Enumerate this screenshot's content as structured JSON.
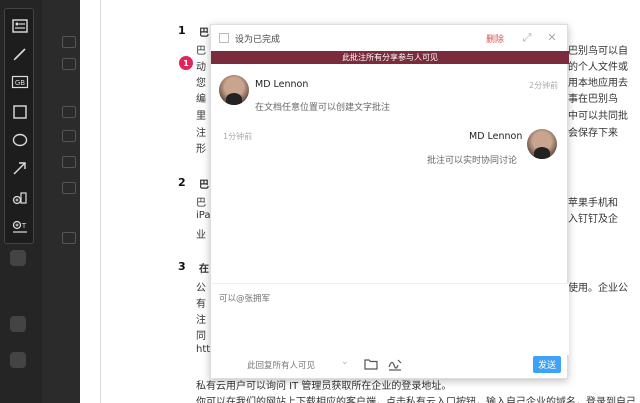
{
  "toolbar": {
    "tools": [
      {
        "name": "text-comment-tool"
      },
      {
        "name": "pencil-tool"
      },
      {
        "name": "gb-tool",
        "label": "GB"
      },
      {
        "name": "rectangle-tool"
      },
      {
        "name": "ellipse-tool"
      },
      {
        "name": "arrow-tool"
      },
      {
        "name": "add-shape-tool"
      },
      {
        "name": "add-text-tool"
      }
    ]
  },
  "document": {
    "sections": [
      {
        "number": "1",
        "heading": "巴"
      },
      {
        "number": "2",
        "heading": "巴"
      },
      {
        "number": "3",
        "heading": "在"
      }
    ],
    "left_lines": [
      "巴",
      "动",
      "您",
      "编",
      "里",
      "注",
      "形",
      "巴",
      "iPa",
      "业",
      "公",
      "有",
      "注",
      "同",
      "htt"
    ],
    "right_lines": [
      "巴别鸟可以自",
      "的个人文件或",
      "用本地应用去",
      "事在巴别鸟",
      "中可以共同批",
      "会保存下来",
      "苹果手机和",
      "入钉钉及企",
      "使用。企业公"
    ],
    "bottom_lines": [
      "私有云用户可以询问 IT 管理员获取所在企业的登录地址。",
      "你可以在我们的网站上下载相应的客户端，点击私有云入口按钮，输入自己企业的域名，登录到自己"
    ],
    "comment_marker": "1"
  },
  "panel": {
    "mark_complete_label": "设为已完成",
    "delete_label": "删除",
    "banner_text": "此批注所有分享参与人可见",
    "comments": [
      {
        "author": "MD Lennon",
        "time": "2分钟前",
        "text": "在文档任意位置可以创建文字批注"
      },
      {
        "author": "MD Lennon",
        "time": "1分钟前",
        "text": "批注可以实时协同讨论"
      }
    ],
    "reply_placeholder": "可以@张拥军",
    "visibility_label": "此回复所有人可见",
    "send_label": "发送"
  }
}
